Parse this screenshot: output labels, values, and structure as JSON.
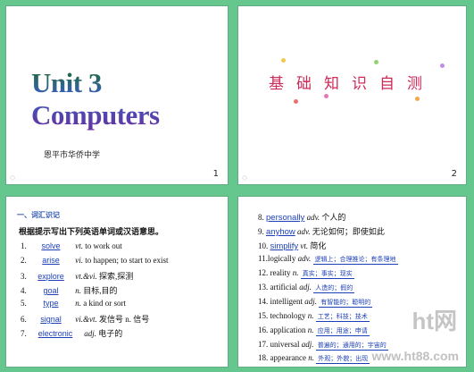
{
  "slide1": {
    "title": "Unit 3 Computers",
    "school": "恩平市华侨中学",
    "page": "1"
  },
  "slide2": {
    "title": "基础知识自测",
    "page": "2"
  },
  "slide3": {
    "heading": "一、词汇识记",
    "instruction": "根据提示写出下列英语单词或汉语意思。",
    "items": [
      {
        "num": "1.",
        "answer": "solve",
        "pos": "vt.",
        "def": "to work out"
      },
      {
        "num": "2.",
        "answer": "arise",
        "pos": "vi.",
        "def": "to happen; to start to exist"
      },
      {
        "num": "3.",
        "answer": "explore",
        "pos": "vt.&vi.",
        "def": "探索,探测"
      },
      {
        "num": "4.",
        "answer": "goal",
        "pos": "n.",
        "def": "目标,目的"
      },
      {
        "num": "5.",
        "answer": "type",
        "pos": "n.",
        "def": "a kind or sort"
      },
      {
        "num": "6.",
        "answer": "signal",
        "pos": "vi.&vt.",
        "def": "发信号 n. 信号"
      },
      {
        "num": "7.",
        "answer": "electronic",
        "pos": "adj.",
        "def": "电子的"
      }
    ]
  },
  "slide4": {
    "items": [
      {
        "num": "8.",
        "answer": "personally",
        "pos": "adv.",
        "def": "个人的"
      },
      {
        "num": "9.",
        "answer": "anyhow",
        "pos": "adv.",
        "def": "无论如何；即使如此"
      },
      {
        "num": "10.",
        "answer": "simplify",
        "pos": "vt.",
        "def": "简化"
      },
      {
        "num": "11.",
        "word": "logically",
        "pos": "adv.",
        "answer": "逻辑上；合理推论；有条理地"
      },
      {
        "num": "12.",
        "word": "reality",
        "pos": "n.",
        "answer": "真实；事实；现实"
      },
      {
        "num": "13.",
        "word": "artificial",
        "pos": "adj.",
        "answer": "人造的；假的"
      },
      {
        "num": "14.",
        "word": "intelligent",
        "pos": "adj.",
        "answer": "有智能的；聪明的"
      },
      {
        "num": "15.",
        "word": "technology",
        "pos": "n.",
        "answer": "工艺；科技；技术"
      },
      {
        "num": "16.",
        "word": "application",
        "pos": "n.",
        "answer": "应用；用途；申请"
      },
      {
        "num": "17.",
        "word": "universal",
        "pos": "adj.",
        "answer": "普遍的；通用的；宇宙的"
      },
      {
        "num": "18.",
        "word": "appearance",
        "pos": "n.",
        "answer": "外观；外貌；出现"
      }
    ]
  },
  "watermark": {
    "logo": "ht网",
    "url": "www.ht88.com"
  }
}
